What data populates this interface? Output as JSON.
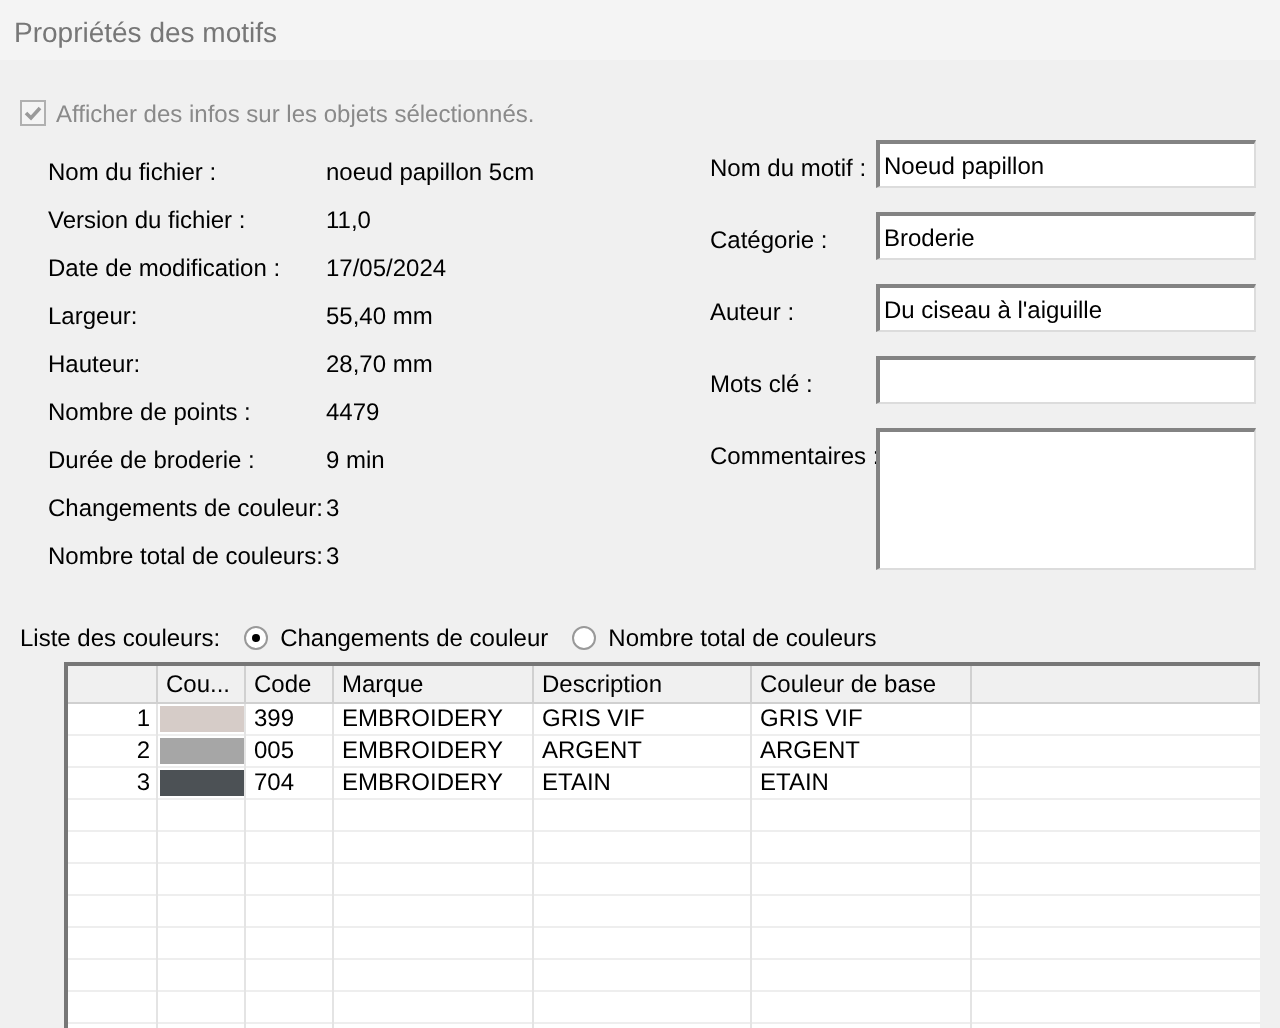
{
  "window": {
    "title": "Propriétés des motifs"
  },
  "show_info": {
    "label": "Afficher des infos sur les objets sélectionnés.",
    "checked": true,
    "disabled": true
  },
  "info": [
    {
      "label": "Nom du fichier :",
      "value": "noeud papillon 5cm"
    },
    {
      "label": "Version du fichier :",
      "value": "11,0"
    },
    {
      "label": "Date de modification :",
      "value": "17/05/2024"
    },
    {
      "label": "Largeur:",
      "value": "55,40 mm"
    },
    {
      "label": "Hauteur:",
      "value": "28,70 mm"
    },
    {
      "label": "Nombre de points :",
      "value": "4479"
    },
    {
      "label": "Durée de broderie :",
      "value": "9 min"
    },
    {
      "label": "Changements de couleur:",
      "value": "3"
    },
    {
      "label": "Nombre total de couleurs:",
      "value": "3"
    }
  ],
  "fields": [
    {
      "label": "Nom du motif :",
      "value": "Noeud papillon",
      "kind": "line"
    },
    {
      "label": "Catégorie :",
      "value": "Broderie",
      "kind": "line"
    },
    {
      "label": "Auteur :",
      "value": "Du ciseau à l'aiguille",
      "kind": "line"
    },
    {
      "label": "Mots clé :",
      "kind": "line"
    },
    {
      "label": "Commentaires :",
      "kind": "area"
    }
  ],
  "color_list": {
    "label": "Liste des couleurs:",
    "options": [
      {
        "label": "Changements de couleur",
        "selected": true
      },
      {
        "label": "Nombre total de couleurs",
        "selected": false
      }
    ]
  },
  "table": {
    "columns": [
      "Cou...",
      "Code",
      "Marque",
      "Description",
      "Couleur de base"
    ],
    "rows": [
      {
        "index": "1",
        "color": "#d6ccc8",
        "code": "399",
        "brand": "EMBROIDERY",
        "description": "GRIS VIF",
        "base": "GRIS VIF"
      },
      {
        "index": "2",
        "color": "#a6a6a6",
        "code": "005",
        "brand": "EMBROIDERY",
        "description": "ARGENT",
        "base": "ARGENT"
      },
      {
        "index": "3",
        "color": "#4c5155",
        "code": "704",
        "brand": "EMBROIDERY",
        "description": "ETAIN",
        "base": "ETAIN"
      }
    ]
  }
}
